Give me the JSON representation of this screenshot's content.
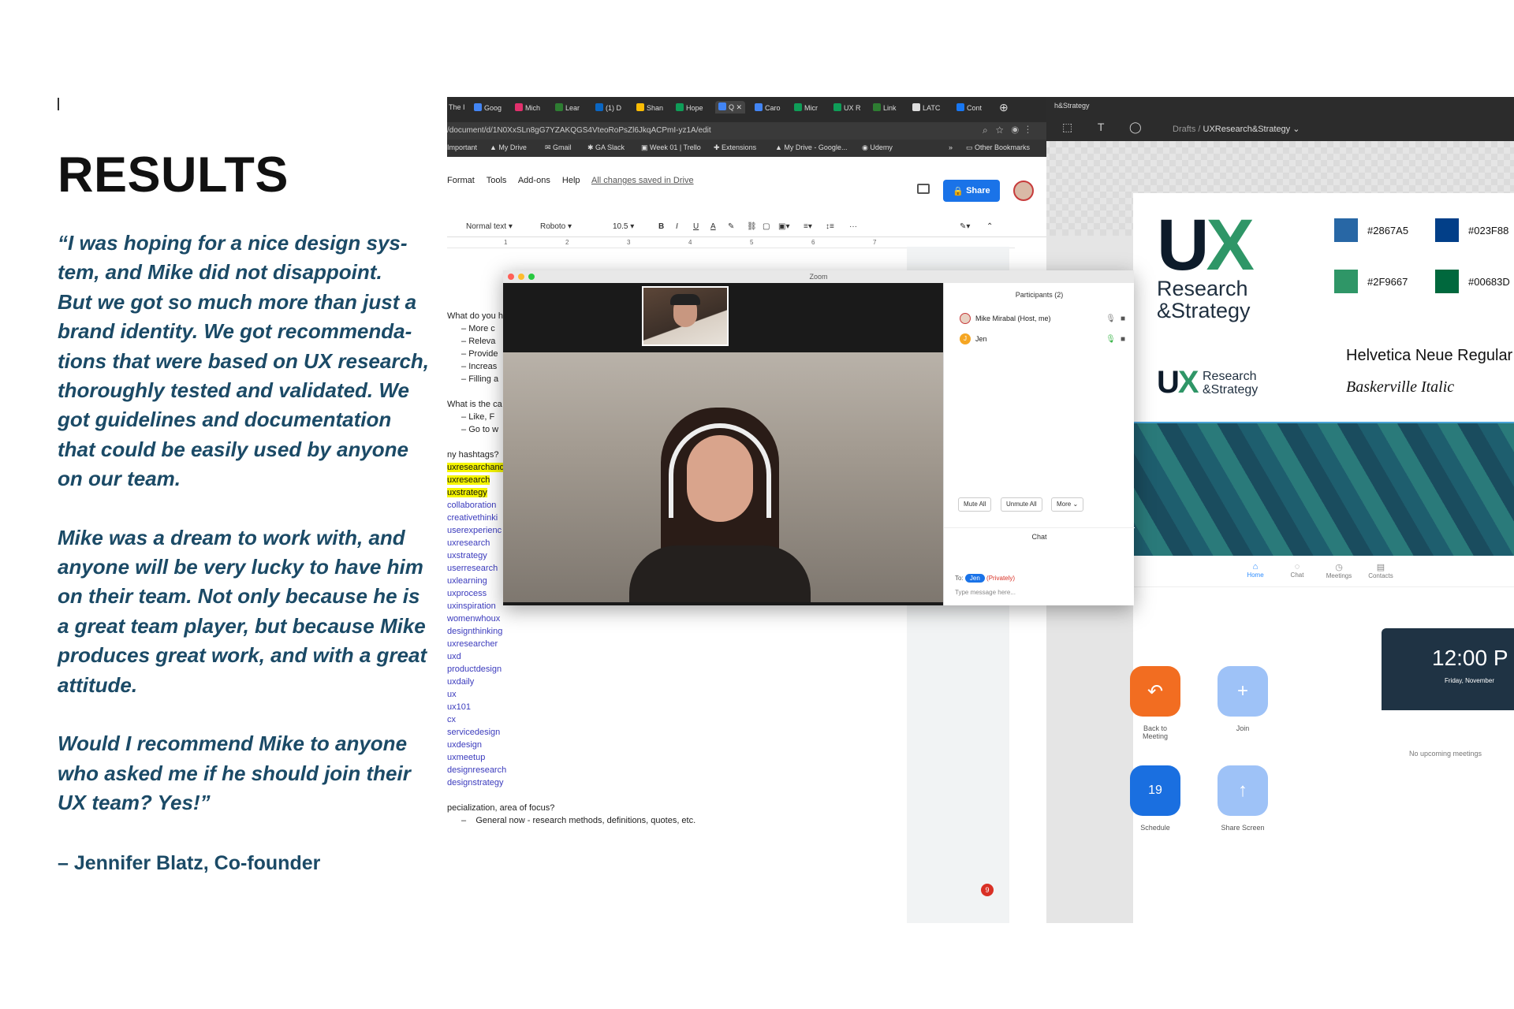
{
  "testimonial": {
    "title": "RESULTS",
    "paragraph1_lines": [
      "“I was hoping for a nice design sys-",
      "tem, and Mike did not disappoint.",
      "But we got so much more than just a",
      "brand identity. We got recommenda-",
      "tions that were based on UX research,",
      "thoroughly tested and validated. We",
      "got guidelines and documentation",
      "that could be easily used by anyone",
      "on our team."
    ],
    "paragraph2_lines": [
      "Mike was a dream to work with, and",
      "anyone will be very lucky to have him",
      "on their team. Not only because he is",
      "a great team player, but because Mike",
      "produces great work, and with a great",
      "attitude."
    ],
    "paragraph3_lines": [
      "Would I recommend Mike to anyone",
      "who asked me if he should join their",
      "UX team? Yes!”"
    ],
    "attribution": "– Jennifer Blatz, Co-founder"
  },
  "browser": {
    "tabs": [
      "The I",
      "Goog",
      "Mich",
      "Lear",
      "(1) D",
      "Shan",
      "Hope",
      "Q",
      "Caro",
      "Micr",
      "UX R",
      "Link",
      "LATC",
      "Cont"
    ],
    "url": "/document/d/1N0XxSLn8gG7YZAKQGS4VteoRoPsZl6JkqACPmI-yz1A/edit",
    "bookmarks": [
      "Important",
      "My Drive",
      "Gmail",
      "GA Slack",
      "Week 01 | Trello",
      "Extensions",
      "My Drive - Google...",
      "Udemy",
      "»",
      "Other Bookmarks"
    ]
  },
  "docs": {
    "menu": [
      "Format",
      "Tools",
      "Add-ons",
      "Help"
    ],
    "saved_status": "All changes saved in Drive",
    "share_label": "Share",
    "toolbar": {
      "style": "Normal text",
      "font": "Roboto",
      "size": "10.5",
      "buttons": [
        "B",
        "I",
        "U",
        "A"
      ],
      "more": "···"
    },
    "ruler": [
      "1",
      "2",
      "3",
      "4",
      "5",
      "6",
      "7"
    ],
    "q1": "What do you h",
    "q1_bullets": [
      "More c",
      "Releva",
      "Provide",
      "Increas",
      "Filling a"
    ],
    "q2": "What is the ca",
    "q2_bullets": [
      "Like, F",
      "Go to w"
    ],
    "q3": "ny hashtags?",
    "hashtags_highlighted": [
      "uxresearchand",
      "uxresearch",
      "uxstrategy"
    ],
    "hashtags": [
      "collaboration",
      "creativethinki",
      "userexperienc",
      "uxresearch",
      "uxstrategy",
      "userresearch",
      "uxlearning",
      "uxprocess",
      "uxinspiration",
      "womenwhoux",
      "designthinking",
      "uxresearcher",
      "uxd",
      "productdesign",
      "uxdaily",
      "ux",
      "ux101",
      "cx",
      "servicedesign",
      "uxdesign",
      "uxmeetup",
      "designresearch",
      "designstrategy"
    ],
    "q4": "pecialization, area of focus?",
    "q4_bullet": "General now - research methods, definitions, quotes, etc.",
    "notification_count": "9"
  },
  "zoom": {
    "window_title": "Zoom",
    "participants_title": "Participants (2)",
    "participants": [
      {
        "name": "Mike Mirabal (Host, me)",
        "initial": ""
      },
      {
        "name": "Jen",
        "initial": "J"
      }
    ],
    "buttons": [
      "Mute All",
      "Unmute All",
      "More ⌄"
    ],
    "chat_title": "Chat",
    "chat_to_label": "To:",
    "chat_recipient": "Jen",
    "chat_private": "(Privately)",
    "chat_placeholder": "Type message here..."
  },
  "figma": {
    "tab": "h&Strategy",
    "breadcrumb_root": "Drafts",
    "breadcrumb_file": "UXResearch&Strategy ⌄"
  },
  "guide": {
    "logo_mark": "UX",
    "logo_x": "X",
    "logo_u": "U",
    "logo_line1": "Research",
    "logo_line2": "&Strategy",
    "colors": [
      {
        "hex": "#2867A5",
        "color": "#2867A5"
      },
      {
        "hex": "#023F88",
        "color": "#023F88"
      },
      {
        "hex": "#2F9667",
        "color": "#2F9667"
      },
      {
        "hex": "#00683D",
        "color": "#00683D"
      }
    ],
    "font_primary": "Helvetica Neue Regular",
    "font_secondary": "Baskerville Italic"
  },
  "zoom_home": {
    "nav": [
      "Home",
      "Chat",
      "Meetings",
      "Contacts"
    ],
    "actions": [
      {
        "label": "Back to Meeting",
        "color": "#f26d21"
      },
      {
        "label": "Join",
        "color": "#9ec2f7"
      },
      {
        "label": "Schedule",
        "color": "#1a6fe0"
      },
      {
        "label": "Share Screen",
        "color": "#9ec2f7"
      }
    ],
    "schedule_day": "19",
    "clock": "12:00 P",
    "date": "Friday, November",
    "no_meetings": "No upcoming meetings"
  }
}
